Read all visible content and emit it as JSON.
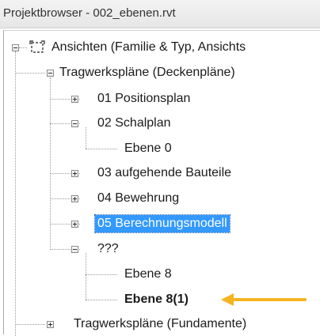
{
  "window": {
    "title": "Projektbrowser - 002_ebenen.rvt"
  },
  "tree": {
    "root": {
      "label": "Ansichten (Familie & Typ, Ansichts"
    },
    "items": [
      {
        "label": "Tragwerkspläne (Deckenpläne)"
      },
      {
        "label": "01 Positionsplan"
      },
      {
        "label": "02 Schalplan"
      },
      {
        "label": "Ebene 0"
      },
      {
        "label": "03 aufgehende Bauteile"
      },
      {
        "label": "04 Bewehrung"
      },
      {
        "label": "05 Berechnungsmodell"
      },
      {
        "label": "???"
      },
      {
        "label": "Ebene 8"
      },
      {
        "label": "Ebene 8(1)"
      },
      {
        "label": "Tragwerkspläne (Fundamente)"
      }
    ]
  },
  "colors": {
    "selection": "#3399ff",
    "arrow": "#f5b321"
  },
  "icons": {
    "root": "view-icon",
    "collapse": "minus-expander-icon",
    "expand": "plus-expander-icon",
    "pointer": "arrow-left-icon"
  }
}
